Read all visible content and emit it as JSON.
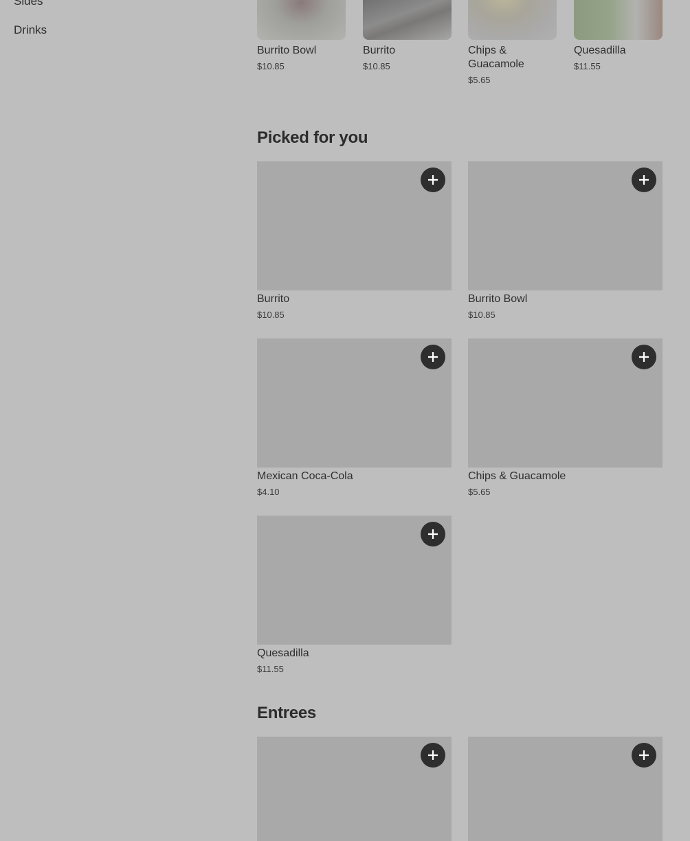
{
  "sidebar": {
    "items": [
      {
        "label": "Sides"
      },
      {
        "label": "Drinks"
      }
    ]
  },
  "carousel": {
    "items": [
      {
        "name": "Burrito Bowl",
        "price": "$10.85"
      },
      {
        "name": "Burrito",
        "price": "$10.85"
      },
      {
        "name": "Chips & Guacamole",
        "price": "$5.65"
      },
      {
        "name": "Quesadilla",
        "price": "$11.55"
      }
    ]
  },
  "picked": {
    "title": "Picked for you",
    "items": [
      {
        "name": "Burrito",
        "price": "$10.85"
      },
      {
        "name": "Burrito Bowl",
        "price": "$10.85"
      },
      {
        "name": "Mexican Coca-Cola",
        "price": "$4.10"
      },
      {
        "name": "Chips & Guacamole",
        "price": "$5.65"
      },
      {
        "name": "Quesadilla",
        "price": "$11.55"
      }
    ]
  },
  "entrees": {
    "title": "Entrees"
  },
  "icons": {
    "add": "plus-icon"
  },
  "colors": {
    "overlay_background": "#bebebe",
    "add_button": "#2e2e2e",
    "image_placeholder": "#a9a9a9"
  }
}
